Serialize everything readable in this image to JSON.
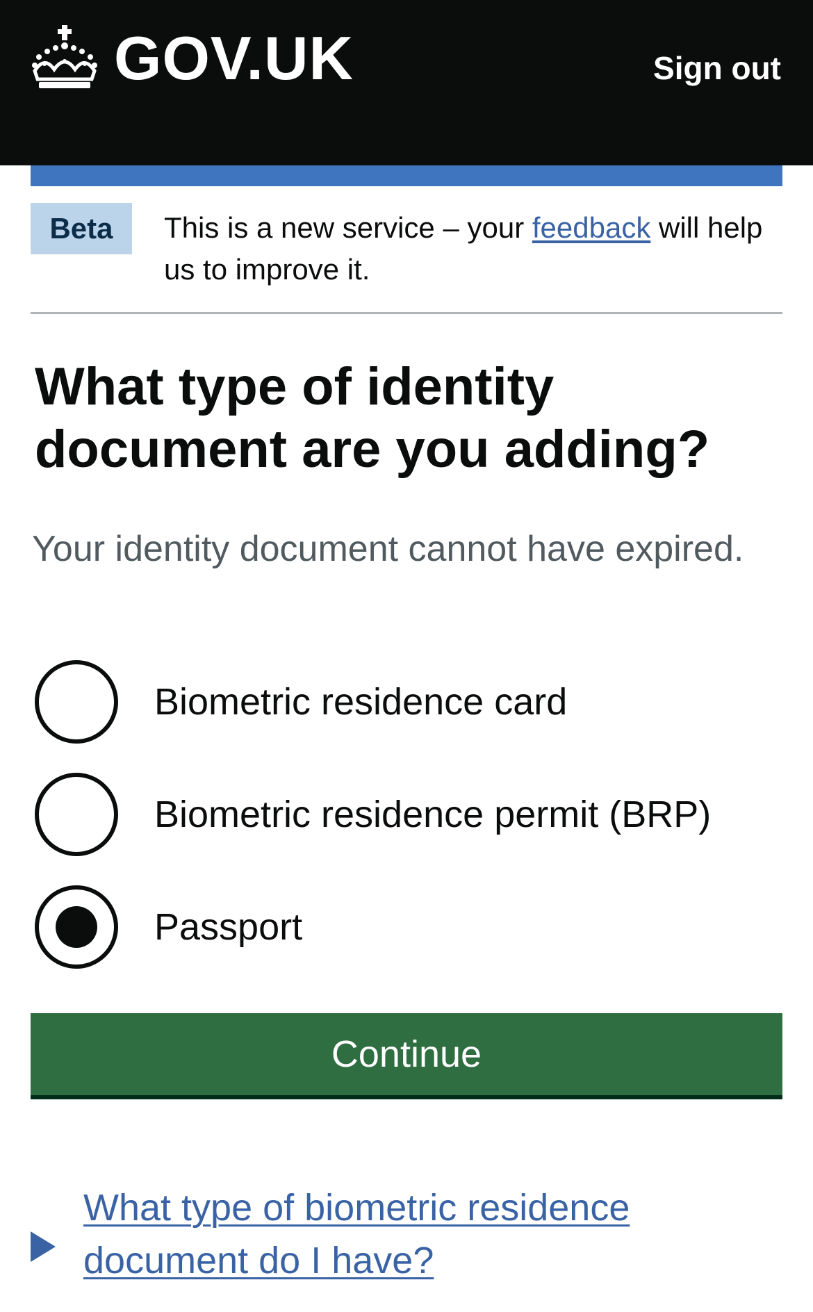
{
  "header": {
    "logo_text": "GOV.UK",
    "sign_out_label": "Sign out",
    "colors": {
      "background": "#0b0c0c",
      "text": "#ffffff",
      "blue_bar": "#3f74be"
    }
  },
  "phase_banner": {
    "tag": "Beta",
    "text_before": "This is a new service – your ",
    "link_text": "feedback",
    "text_after": " will help us to improve it."
  },
  "main": {
    "heading": "What type of identity document are you adding?",
    "hint": "Your identity document cannot have expired.",
    "options": [
      {
        "label": "Biometric residence card",
        "selected": false
      },
      {
        "label": "Biometric residence permit (BRP)",
        "selected": false
      },
      {
        "label": "Passport",
        "selected": true
      }
    ],
    "continue_label": "Continue",
    "continue_color": "#2f6e40",
    "details_summary": "What type of biometric residence document do I have?",
    "link_color": "#3a63a5"
  }
}
